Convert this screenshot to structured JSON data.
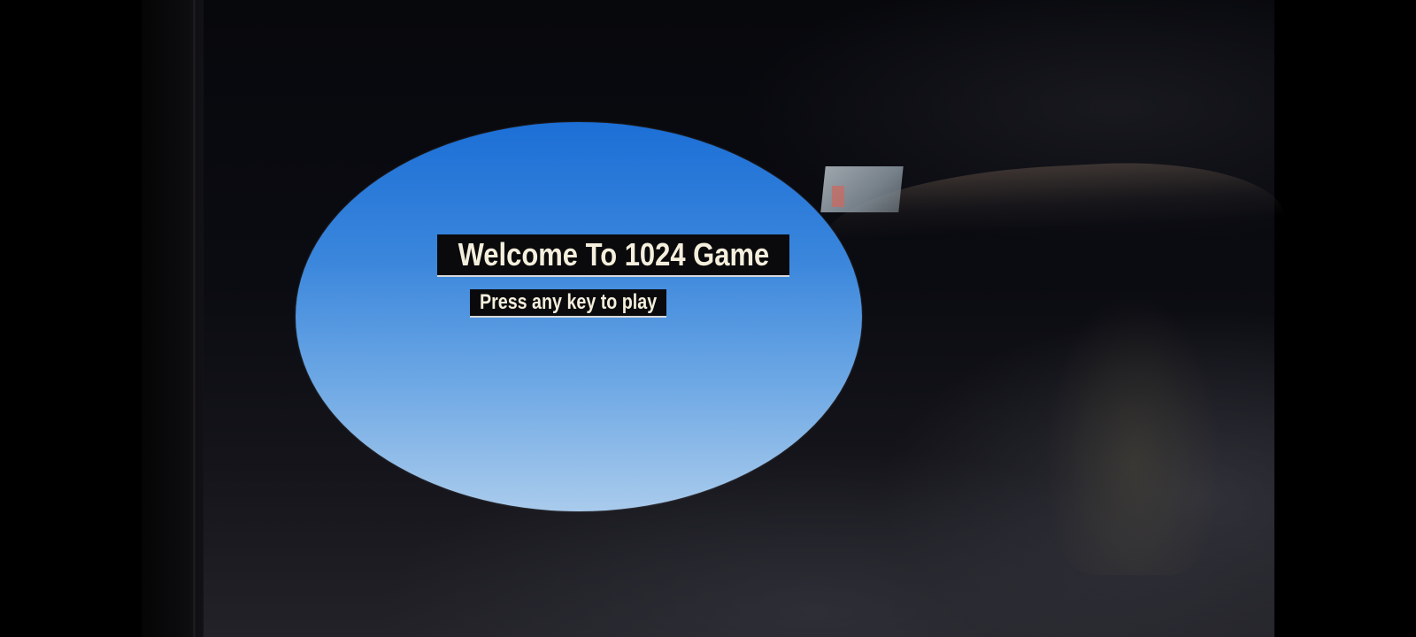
{
  "game": {
    "title": "Welcome To 1024 Game",
    "prompt": "Press any key to play"
  },
  "colors": {
    "sky_top": "#1c6fd6",
    "sky_bottom": "#a9cbec",
    "banner_background": "#0a0a0c",
    "banner_text": "#f4eedc",
    "screen_background": "#07080c"
  }
}
